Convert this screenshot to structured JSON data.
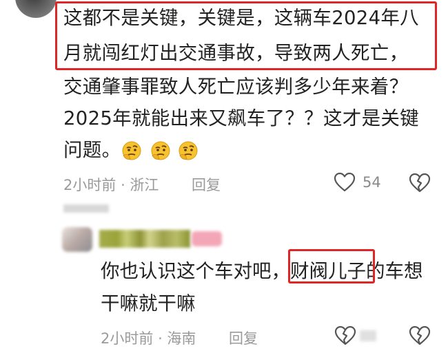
{
  "comment1": {
    "lines": [
      "这都不是关键，关键是，这辆车2024年八",
      "月就闯红灯出交通事故，导致两人死亡，",
      "交通肇事罪致人死亡应该判多少年来着？",
      "2025年就能出来又飙车了？？这才是关键",
      "问题。"
    ],
    "emojis": [
      "thinking-face",
      "thinking-face",
      "thinking-face"
    ],
    "time": "2小时前",
    "location": "浙江",
    "reply_label": "回复",
    "likes": "54"
  },
  "comment2": {
    "lines": [
      "你也认识这个车对吧，财阀儿子的车想",
      "干嘛就干嘛"
    ],
    "time": "2小时前",
    "location": "海南",
    "reply_label": "回复"
  },
  "colors": {
    "highlight": "#e02525",
    "meta_text": "#9a9a9a",
    "body_text": "#222222"
  }
}
